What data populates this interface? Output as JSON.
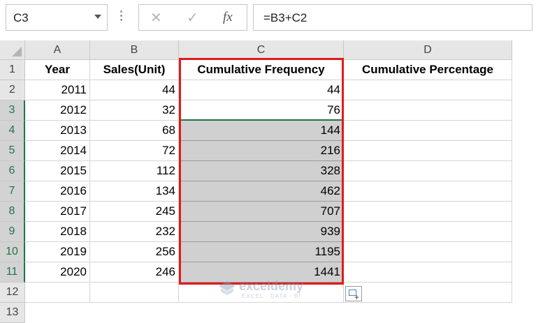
{
  "formula_bar": {
    "name_box": "C3",
    "cancel_icon": "✕",
    "enter_icon": "✓",
    "fx_label": "fx",
    "formula": "=B3+C2"
  },
  "columns": [
    "A",
    "B",
    "C",
    "D"
  ],
  "row_numbers": [
    "1",
    "2",
    "3",
    "4",
    "5",
    "6",
    "7",
    "8",
    "9",
    "10",
    "11",
    "12",
    "13"
  ],
  "headers": {
    "year": "Year",
    "sales": "Sales(Unit)",
    "cum_freq": "Cumulative Frequency",
    "cum_pct": "Cumulative Percentage"
  },
  "rows": [
    {
      "year": "2011",
      "sales": "44",
      "cum": "44"
    },
    {
      "year": "2012",
      "sales": "32",
      "cum": "76"
    },
    {
      "year": "2013",
      "sales": "68",
      "cum": "144"
    },
    {
      "year": "2014",
      "sales": "72",
      "cum": "216"
    },
    {
      "year": "2015",
      "sales": "112",
      "cum": "328"
    },
    {
      "year": "2016",
      "sales": "134",
      "cum": "462"
    },
    {
      "year": "2017",
      "sales": "245",
      "cum": "707"
    },
    {
      "year": "2018",
      "sales": "232",
      "cum": "939"
    },
    {
      "year": "2019",
      "sales": "256",
      "cum": "1195"
    },
    {
      "year": "2020",
      "sales": "246",
      "cum": "1441"
    }
  ],
  "watermark": {
    "name": "exceldemy",
    "tagline": "EXCEL · DATA · BI"
  },
  "colors": {
    "highlight_border": "#e01b1b",
    "selection_green": "#217346",
    "fill_grey": "#d0d0d0"
  }
}
